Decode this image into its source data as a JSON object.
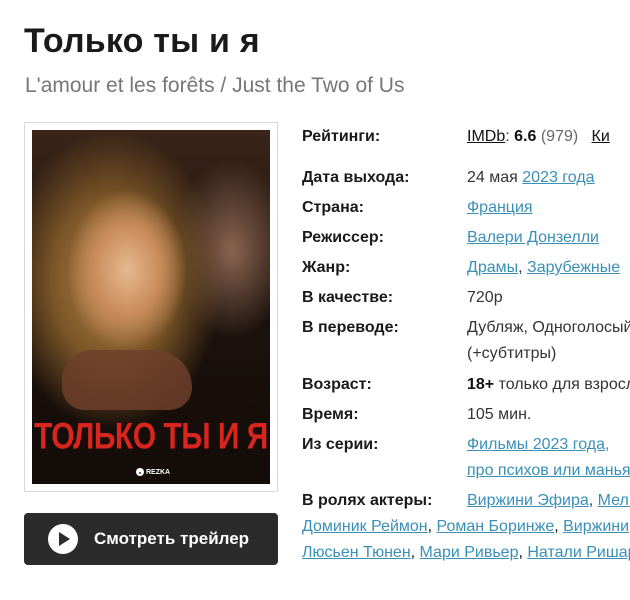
{
  "title": "Только ты и я",
  "subtitle": "L'amour et les forêts / Just the Two of Us",
  "poster": {
    "title_text": "ТОЛЬКО ТЫ И Я",
    "logo_text": "REZKA"
  },
  "trailer_button": {
    "label": "Смотреть трейлер"
  },
  "info": {
    "ratings": {
      "label": "Рейтинги:",
      "imdb_label": "IMDb",
      "imdb_colon": ":",
      "imdb_score": "6.6",
      "imdb_votes": "(979)",
      "other": "Ки"
    },
    "release": {
      "label": "Дата выхода:",
      "date": "24 мая",
      "year": "2023 года"
    },
    "country": {
      "label": "Страна:",
      "value": "Франция"
    },
    "director": {
      "label": "Режиссер:",
      "value": "Валери Донзелли"
    },
    "genre": {
      "label": "Жанр:",
      "items": [
        "Драмы",
        "Зарубежные"
      ]
    },
    "quality": {
      "label": "В качестве:",
      "value": "720p"
    },
    "translation": {
      "label": "В переводе:",
      "line1": "Дубляж, Одноголосый",
      "line2": "(+субтитры)"
    },
    "age": {
      "label": "Возраст:",
      "rating": "18+",
      "text": "только для взрослых"
    },
    "duration": {
      "label": "Время:",
      "value": "105 мин."
    },
    "series": {
      "label": "Из серии:",
      "line1": "Фильмы 2023 года,",
      "line2": "про психов или маньяков"
    },
    "cast": {
      "label": "В ролях актеры:",
      "line1": [
        "Виржини Эфира",
        "Мелвиль Пупо"
      ],
      "line2": [
        "Доминик Реймон",
        "Роман Боринже",
        "Виржини"
      ],
      "line3": [
        "Люсьен Тюнен",
        "Мари Ривьер",
        "Натали Ришар"
      ]
    }
  }
}
